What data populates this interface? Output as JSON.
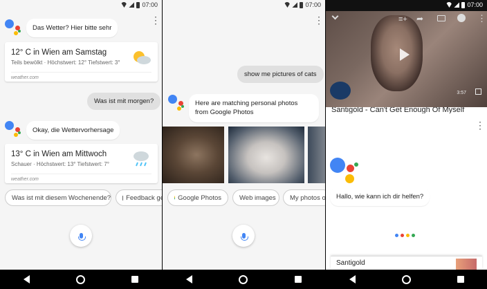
{
  "status": {
    "time": "07:00"
  },
  "screen1": {
    "assistant_greeting": "Das Wetter? Hier bitte sehr",
    "card1": {
      "title": "12° C in Wien am Samstag",
      "subtitle": "Teils bewölkt · Höchstwert: 12° Tiefstwert: 3°",
      "source": "weather.com"
    },
    "user_query": "Was ist mit morgen?",
    "assistant_reply": "Okay, die Wettervorhersage",
    "card2": {
      "title": "13° C in Wien am Mittwoch",
      "subtitle": "Schauer · Höchstwert: 13° Tiefstwert: 7°",
      "source": "weather.com"
    },
    "chips": [
      "Was ist mit diesem Wochenende?",
      "Feedback ge"
    ]
  },
  "screen2": {
    "user_query": "show me pictures of cats",
    "assistant_reply": "Here are matching personal photos from Google Photos",
    "chips": [
      "Google Photos",
      "Web images",
      "My photos of"
    ]
  },
  "screen3": {
    "video_title": "Santigold - Can't Get Enough Of Myself",
    "video_time": "3:57",
    "assistant_greeting": "Hallo, wie kann ich dir helfen?",
    "result_title": "Santigold"
  },
  "colors": {
    "blue": "#4285f4",
    "red": "#ea4335",
    "yellow": "#fbbc05",
    "green": "#34a853"
  }
}
